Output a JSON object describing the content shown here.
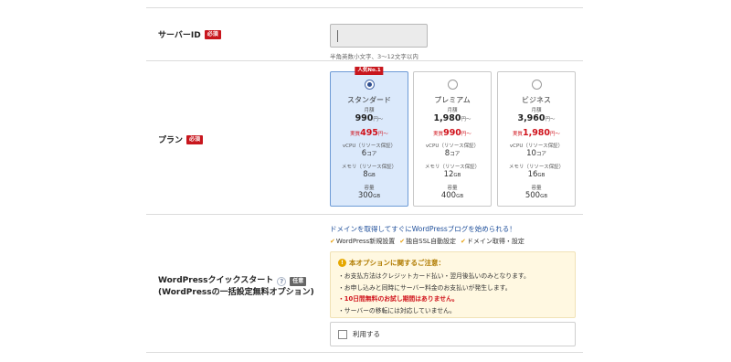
{
  "server": {
    "label": "サーバーID",
    "required": "必須",
    "input_value": "",
    "hint": "半角英数小文字、3〜12文字以内"
  },
  "plan": {
    "label": "プラン",
    "required": "必須",
    "cards": [
      {
        "ribbon": "人気No.1",
        "name": "スタンダード",
        "selected": true,
        "monthly_label": "月額",
        "price": "990",
        "price_unit": "円〜",
        "disc_prefix": "実質",
        "disc_value": "495",
        "disc_unit": "円〜",
        "vcpu_label": "vCPU（リソース保証）",
        "vcpu_value": "6",
        "vcpu_unit": "コア",
        "mem_label": "メモリ（リソース保証）",
        "mem_value": "8",
        "mem_unit": "GB",
        "storage_label": "容量",
        "storage_value": "300",
        "storage_unit": "GB"
      },
      {
        "name": "プレミアム",
        "selected": false,
        "monthly_label": "月額",
        "price": "1,980",
        "price_unit": "円〜",
        "disc_prefix": "実質",
        "disc_value": "990",
        "disc_unit": "円〜",
        "vcpu_label": "vCPU（リソース保証）",
        "vcpu_value": "8",
        "vcpu_unit": "コア",
        "mem_label": "メモリ（リソース保証）",
        "mem_value": "12",
        "mem_unit": "GB",
        "storage_label": "容量",
        "storage_value": "400",
        "storage_unit": "GB"
      },
      {
        "name": "ビジネス",
        "selected": false,
        "monthly_label": "月額",
        "price": "3,960",
        "price_unit": "円〜",
        "disc_prefix": "実質",
        "disc_value": "1,980",
        "disc_unit": "円〜",
        "vcpu_label": "vCPU（リソース保証）",
        "vcpu_value": "10",
        "vcpu_unit": "コア",
        "mem_label": "メモリ（リソース保証）",
        "mem_value": "16",
        "mem_unit": "GB",
        "storage_label": "容量",
        "storage_value": "500",
        "storage_unit": "GB"
      }
    ]
  },
  "wp": {
    "label_line1": "WordPressクイックスタート",
    "label_line2": "(WordPressの一括設定無料オプション)",
    "help": "?",
    "optional": "任意",
    "promo": "ドメインを取得してすぐにWordPressブログを始められる！",
    "checks": [
      "WordPress新規設置",
      "独自SSL自動設定",
      "ドメイン取得・設定"
    ],
    "notice_title": "本オプションに関するご注意：",
    "notice_items": [
      "お支払方法はクレジットカード払い・翌月後払いのみとなります。",
      "お申し込みと同時にサーバー料金のお支払いが発生します。",
      "10日間無料のお試し期間はありません。",
      "サーバーの移転には対応していません。"
    ],
    "use_label": "利用する",
    "use_checked": false
  },
  "colors": {
    "required_badge": "#c8161d",
    "selected_card_bg": "#dbe9fb",
    "discount_red": "#d0121b",
    "promo_blue": "#1f4f9a",
    "check_orange": "#e8a317",
    "notice_bg": "#fff8e1"
  }
}
